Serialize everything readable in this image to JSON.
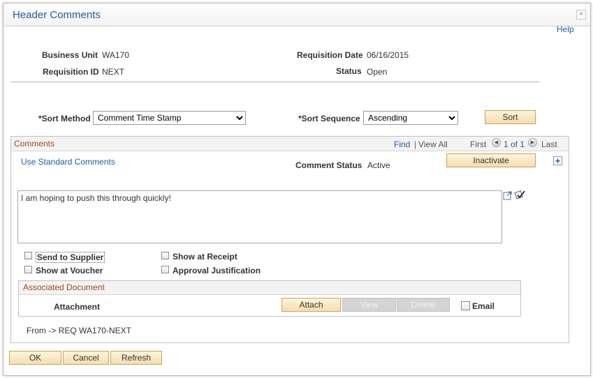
{
  "window": {
    "title": "Header Comments",
    "help": "Help"
  },
  "header": {
    "business_unit_label": "Business Unit",
    "business_unit": "WA170",
    "requisition_id_label": "Requisition ID",
    "requisition_id": "NEXT",
    "requisition_date_label": "Requisition Date",
    "requisition_date": "06/16/2015",
    "status_label": "Status",
    "status": "Open"
  },
  "sort": {
    "method_label": "*Sort Method",
    "method_value": "Comment Time Stamp",
    "sequence_label": "*Sort Sequence",
    "sequence_value": "Ascending",
    "sort_button": "Sort"
  },
  "comments": {
    "title": "Comments",
    "find": "Find",
    "separator": "|",
    "view_all": "View All",
    "first": "First",
    "page_info": "1 of 1",
    "last": "Last",
    "use_standard": "Use Standard Comments",
    "status_label": "Comment Status",
    "status_value": "Active",
    "inactivate_button": "Inactivate",
    "text": "I am hoping to push this through quickly!",
    "checkboxes": {
      "send_to_supplier": "Send to Supplier",
      "show_at_receipt": "Show at Receipt",
      "show_at_voucher": "Show at Voucher",
      "approval_justification": "Approval Justification"
    }
  },
  "associated": {
    "title": "Associated Document",
    "attachment_label": "Attachment",
    "attach_button": "Attach",
    "view_button": "View",
    "delete_button": "Delete",
    "email_label": "Email"
  },
  "from_text": "From -> REQ WA170-NEXT",
  "footer": {
    "ok": "OK",
    "cancel": "Cancel",
    "refresh": "Refresh"
  }
}
